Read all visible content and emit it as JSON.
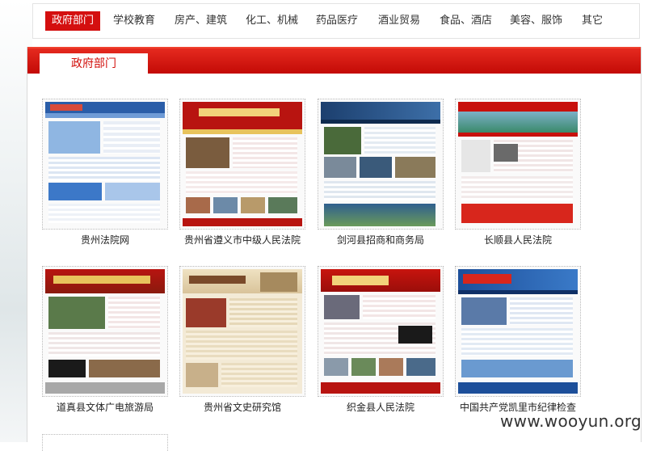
{
  "nav": {
    "items": [
      {
        "label": "政府部门",
        "active": true
      },
      {
        "label": "学校教育",
        "active": false
      },
      {
        "label": "房产、建筑",
        "active": false
      },
      {
        "label": "化工、机械",
        "active": false
      },
      {
        "label": "药品医疗",
        "active": false
      },
      {
        "label": "酒业贸易",
        "active": false
      },
      {
        "label": "食品、酒店",
        "active": false
      },
      {
        "label": "美容、服饰",
        "active": false
      },
      {
        "label": "其它",
        "active": false
      }
    ]
  },
  "panel": {
    "tab_label": "政府部门"
  },
  "cards": [
    {
      "caption": "贵州法院网",
      "theme": "blue"
    },
    {
      "caption": "贵州省遵义市中级人民法院",
      "theme": "red"
    },
    {
      "caption": "剑河县招商和商务局",
      "theme": "darkblue"
    },
    {
      "caption": "长顺县人民法院",
      "theme": "red-green"
    },
    {
      "caption": "道真县文体广电旅游局",
      "theme": "red"
    },
    {
      "caption": "贵州省文史研究馆",
      "theme": "beige"
    },
    {
      "caption": "织金县人民法院",
      "theme": "red"
    },
    {
      "caption": "中国共产党凯里市纪律检查",
      "theme": "blue"
    }
  ],
  "watermark": "www.wooyun.org",
  "colors": {
    "accent": "#d40f0f",
    "panel_header": "#d2100c"
  }
}
